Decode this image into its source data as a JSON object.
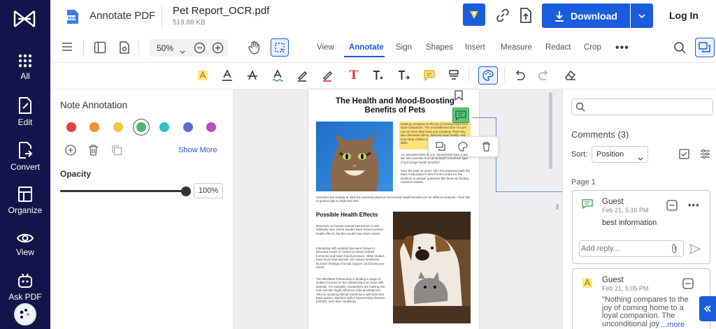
{
  "rail": {
    "items": [
      {
        "label": "All"
      },
      {
        "label": "Edit"
      },
      {
        "label": "Convert"
      },
      {
        "label": "Organize"
      },
      {
        "label": "View"
      },
      {
        "label": "Ask PDF"
      }
    ]
  },
  "header": {
    "app_name": "Annotate PDF",
    "file_name": "Pet Report_OCR.pdf",
    "file_size": "519.88 KB",
    "download_label": "Download",
    "login_label": "Log In"
  },
  "toolbar": {
    "zoom": "50%",
    "tabs": [
      "View",
      "Annotate",
      "Sign",
      "Shapes",
      "Insert",
      "Measure",
      "Redact",
      "Crop"
    ],
    "active_tab": "Annotate"
  },
  "left_panel": {
    "title": "Note Annotation",
    "colors": [
      "#e0443c",
      "#f0932b",
      "#f5c542",
      "#4cba6b",
      "#2cc4c4",
      "#5a6ed6",
      "#b84cc4"
    ],
    "selected_color": "#4cba6b",
    "show_more": "Show More",
    "opacity_label": "Opacity",
    "opacity_value": "100%",
    "opacity": 1.0
  },
  "document": {
    "title": "The Health and Mood-Boosting Benefits of Pets",
    "highlight_text": "Nothing compares to the joy of coming home to a loyal companion. The unconditional love of a pet can do more than keep you company. Pets may also decrease stress, improve heart health, and even help children with their emotional and social skills.",
    "para1": "An estimated 68% of U.S. households have a pet. But who benefits from an animal? And which type of pet brings health benefits?",
    "para2": "Over the past 10 years, NIH has partnered with the Mars Corporation's WALTHAM Centre for Pet Nutrition to answer questions like these by funding research studies.",
    "caption": "Scientists are looking at what the potential physical and mental health benefits are for different animals—from fish to guinea pigs to dogs and cats.",
    "section_heading": "Possible Health Effects",
    "para3": "Research on human-animal interactions is still relatively new. Some studies have shown positive health effects, but the results have been mixed.",
    "para4": "Interacting with animals has been shown to decrease levels of cortisol (a stress-related hormone) and lower blood pressure. Other studies have found that animals can reduce loneliness, increase feelings of social support, and boost your mood.",
    "para5": "The NIH/Mars Partnership is funding a range of studies focused on the relationships we have with animals. For example, researchers are looking into how animals might influence child development. They're studying animal interactions with kids who have autism, attention deficit hyperactivity disorder (ADHD), and other conditions."
  },
  "right_panel": {
    "search_placeholder": "",
    "comments_title": "Comments (3)",
    "sort_label": "Sort:",
    "sort_value": "Position",
    "page_label": "Page 1",
    "comments": [
      {
        "author": "Guest",
        "date": "Feb 21, 5:16 PM",
        "text": "best information",
        "reply_placeholder": "Add reply..."
      },
      {
        "author": "Guest",
        "date": "Feb 21, 5:05 PM",
        "text": "\"Nothing compares to the joy of coming home to a loyal companion. The unconditional joy",
        "more": "...more"
      }
    ]
  }
}
